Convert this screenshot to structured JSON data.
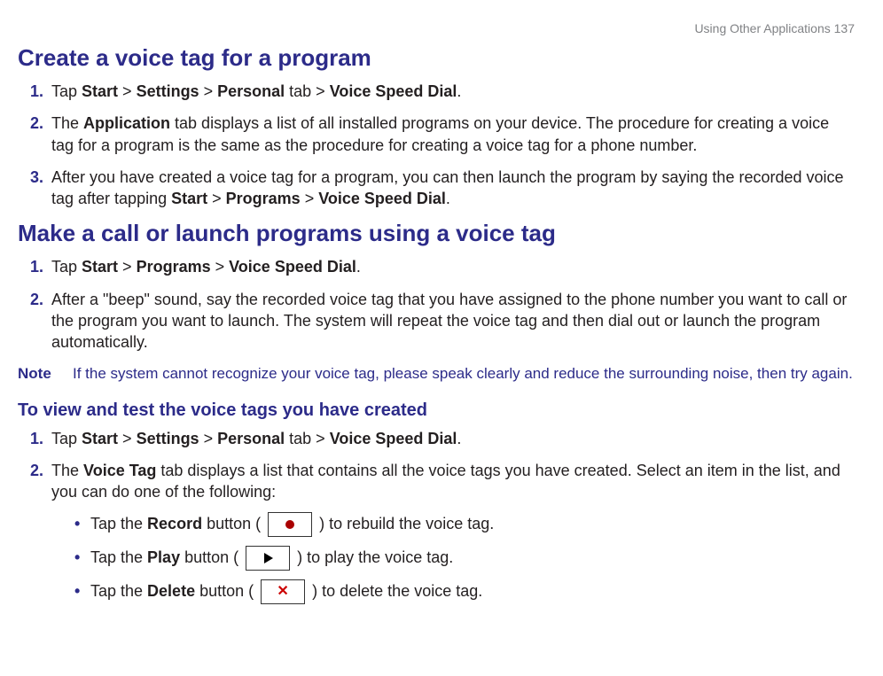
{
  "header": {
    "running": "Using Other Applications  137"
  },
  "section1": {
    "title": "Create a voice tag for a program",
    "steps": [
      {
        "num": "1.",
        "pre": "Tap ",
        "b1": "Start",
        "s1": " > ",
        "b2": "Settings",
        "s2": " > ",
        "b3": "Personal",
        "s3": " tab > ",
        "b4": "Voice Speed Dial",
        "post": "."
      },
      {
        "num": "2.",
        "pre": "The ",
        "b1": "Application",
        "post": " tab displays a list of all installed programs on your device. The procedure for creating a voice tag for a program is the same as the procedure for creating a voice tag for a phone number."
      },
      {
        "num": "3.",
        "pre": "After you have created a voice tag for a program, you can then launch the program by saying the recorded voice tag after tapping ",
        "b1": "Start",
        "s1": " > ",
        "b2": "Programs",
        "s2": " > ",
        "b3": "Voice Speed Dial",
        "post": "."
      }
    ]
  },
  "section2": {
    "title": "Make a call or launch programs using a voice tag",
    "steps": [
      {
        "num": "1.",
        "pre": "Tap ",
        "b1": "Start",
        "s1": " > ",
        "b2": "Programs",
        "s2": " > ",
        "b3": "Voice Speed Dial",
        "post": "."
      },
      {
        "num": "2.",
        "pre": "After a \"beep\" sound, say the recorded voice tag that you have assigned to the phone number you want to call or the program you want to launch. The system will repeat the voice tag and then dial out or launch the program automatically."
      }
    ],
    "note_label": "Note",
    "note_body": "If the system cannot recognize your voice tag, please speak clearly and reduce the surrounding noise, then try again."
  },
  "section3": {
    "title": "To view and test the voice tags you have created",
    "steps": [
      {
        "num": "1.",
        "pre": "Tap ",
        "b1": "Start",
        "s1": " > ",
        "b2": "Settings",
        "s2": " > ",
        "b3": "Personal",
        "s3": " tab > ",
        "b4": "Voice Speed Dial",
        "post": "."
      },
      {
        "num": "2.",
        "pre": "The ",
        "b1": "Voice Tag",
        "post": " tab displays a list that contains all the voice tags you have created. Select an item in the list, and you can do one of the following:"
      }
    ],
    "bullets": [
      {
        "pre": "Tap the ",
        "b": "Record",
        "mid": " button ( ",
        "icon": "record",
        "post": " ) to rebuild the voice tag."
      },
      {
        "pre": "Tap the ",
        "b": "Play",
        "mid": " button ( ",
        "icon": "play",
        "post": " ) to play the voice tag."
      },
      {
        "pre": "Tap the ",
        "b": "Delete",
        "mid": " button ( ",
        "icon": "delete",
        "post": " ) to delete the voice tag."
      }
    ]
  }
}
